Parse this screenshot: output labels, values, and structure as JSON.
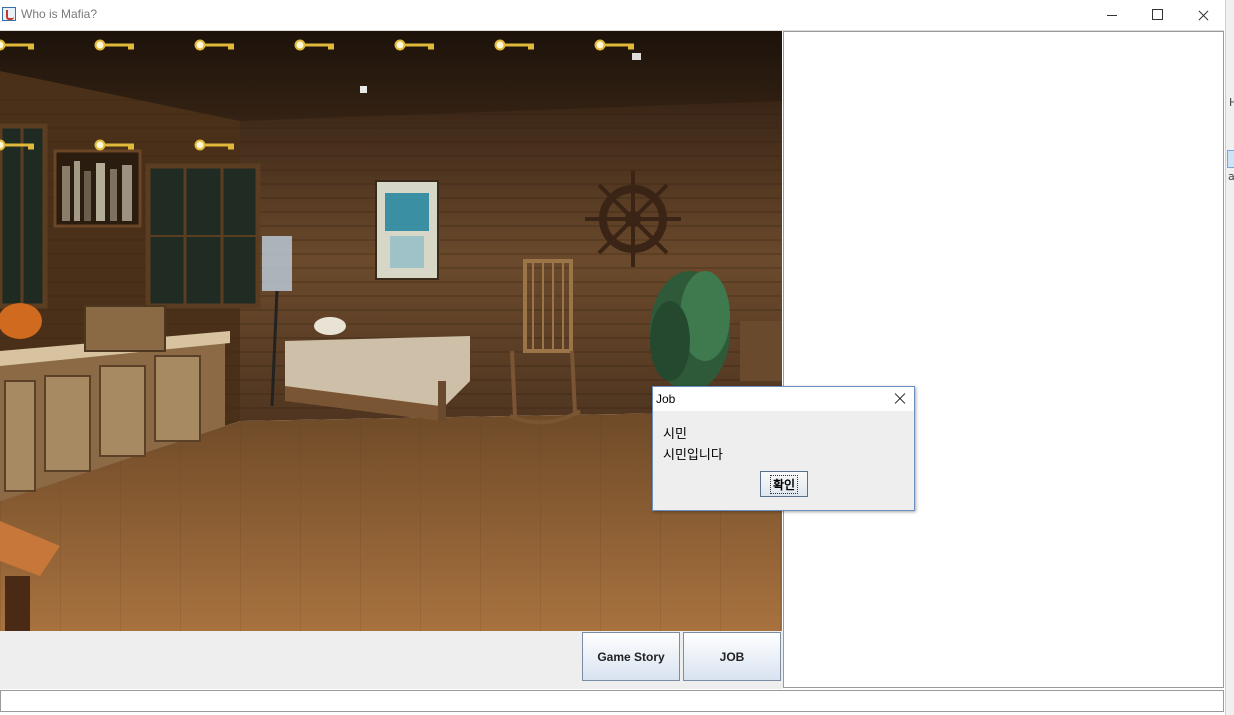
{
  "window": {
    "title": "Who is Mafia?"
  },
  "bg_strip": {
    "text1": "H",
    "text2": "a"
  },
  "buttons": {
    "game_story": "Game Story",
    "job": "JOB"
  },
  "dialog": {
    "title": "Job",
    "line1": "시민",
    "line2": "시민입니다",
    "ok": "확인"
  },
  "keys": {
    "row1_count": 7,
    "row2_count": 3
  },
  "colors": {
    "key_gold": "#e0b83a",
    "button_border": "#7a8da5",
    "dialog_border": "#6b8fbf"
  }
}
